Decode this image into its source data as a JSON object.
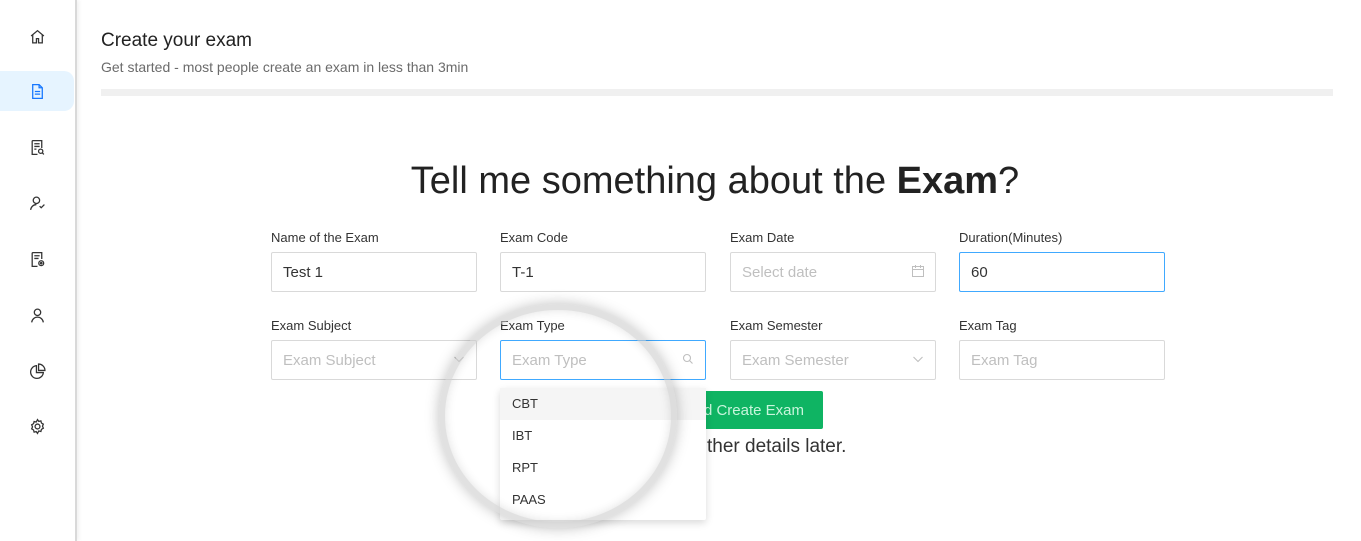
{
  "header": {
    "title": "Create your exam",
    "subtitle": "Get started - most people create an exam in less than 3min"
  },
  "sidebar": {
    "items": [
      {
        "icon": "home-icon"
      },
      {
        "icon": "document-icon",
        "active": true
      },
      {
        "icon": "exam-list-icon"
      },
      {
        "icon": "users-icon"
      },
      {
        "icon": "report-settings-icon"
      },
      {
        "icon": "user-icon"
      },
      {
        "icon": "pie-chart-icon"
      },
      {
        "icon": "gear-icon"
      }
    ]
  },
  "headline": {
    "prefix": "Tell me something about the ",
    "bold": "Exam",
    "suffix": "?"
  },
  "form": {
    "name": {
      "label": "Name of the Exam",
      "value": "Test 1"
    },
    "code": {
      "label": "Exam Code",
      "value": "T-1"
    },
    "date": {
      "label": "Exam Date",
      "placeholder": "Select date"
    },
    "duration": {
      "label": "Duration(Minutes)",
      "value": "60"
    },
    "subject": {
      "label": "Exam Subject",
      "placeholder": "Exam Subject"
    },
    "type": {
      "label": "Exam Type",
      "placeholder": "Exam Type"
    },
    "semester": {
      "label": "Exam Semester",
      "placeholder": "Exam Semester"
    },
    "tag": {
      "label": "Exam Tag",
      "placeholder": "Exam Tag"
    }
  },
  "create_button": "d Create Exam",
  "later_text": "ther details later.",
  "dropdown": {
    "options": [
      "CBT",
      "IBT",
      "RPT",
      "PAAS"
    ]
  },
  "colors": {
    "accent": "#40a9ff",
    "active_bg": "#e6f4ff",
    "button_green": "#0fb463"
  }
}
